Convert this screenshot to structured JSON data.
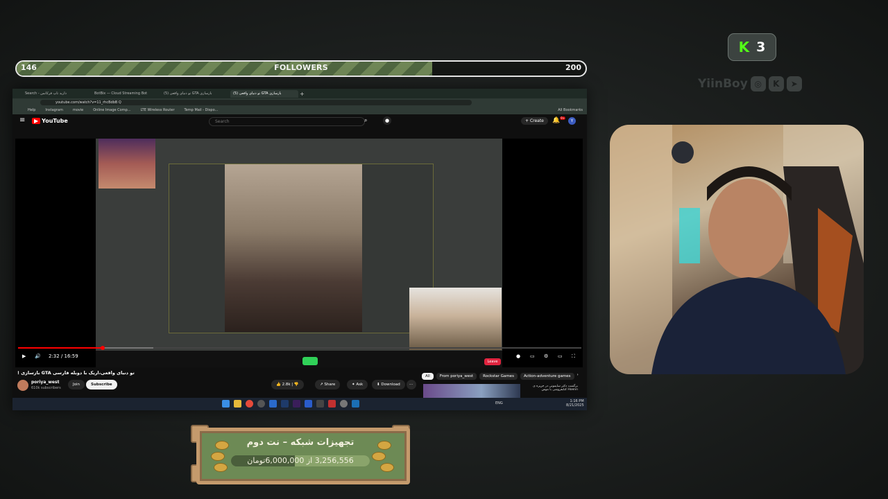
{
  "followers": {
    "current": "146",
    "label": "FOLLOWERS",
    "target": "200",
    "progress": 0.73
  },
  "kick": {
    "logo_letter": "K",
    "count": "3"
  },
  "social": {
    "handle": "YiinBoy",
    "icons": [
      "instagram-icon",
      "kick-icon",
      "telegram-icon"
    ]
  },
  "browser": {
    "tabs": [
      {
        "label": "Search - دارید تاپ فرکانس"
      },
      {
        "label": "BotBix — Cloud Streaming Bot"
      },
      {
        "label": "(5) تو دنیای واقعی GTA بازسازی"
      },
      {
        "label": "(5) تو دنیای واقعی GTA بازسازی"
      }
    ],
    "url": "youtube.com/watch?v=11_rhcBdbB Q",
    "bookmarks": [
      "Help",
      "Instagram",
      "movie",
      "Online Image Comp...",
      "LTE Wireless Router",
      "Temp Mail - Dispo...",
      "All Bookmarks"
    ]
  },
  "youtube": {
    "logo": "YouTube",
    "search_placeholder": "Search",
    "create_label": "Create",
    "notification_count": "9+",
    "avatar_letter": "Y",
    "time": "2:32 / 16:59",
    "progress": 0.15,
    "leave_label": "Leave",
    "video_title": "تو دنیای واقعی،اریک با دوبله فارسی GTA بازسازی !",
    "channel": {
      "name": "poriya_west",
      "subs": "610k subscribers"
    },
    "join_label": "Join",
    "subscribe_label": "Subscribe",
    "likes": "2.8k",
    "share_label": "Share",
    "ask_label": "Ask",
    "download_label": "Download",
    "chips": [
      "All",
      "From poriya_west",
      "Rockstar Games",
      "Action-adventure games"
    ],
    "recommend_title": "برگشت دکتر سایمونی در جزیره ی Hoenn کتابفروشی با موس"
  },
  "taskbar": {
    "tray": "ENG",
    "time": "1:16 PM",
    "date": "8/21/2025"
  },
  "donation_goal": {
    "title": "تجهیزات شبکه – نت دوم",
    "current": "3,256,556",
    "separator": "از",
    "target": "6,000,000",
    "currency": "تومان",
    "progress": 0.54
  }
}
